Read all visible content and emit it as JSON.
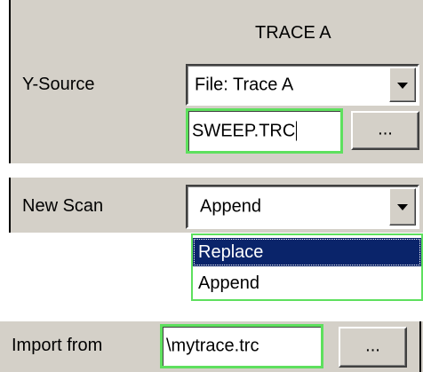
{
  "trace_panel": {
    "header": "TRACE A",
    "y_source": {
      "label": "Y-Source",
      "selected": "File: Trace A",
      "filename": "SWEEP.TRC",
      "browse_label": "..."
    }
  },
  "scan_panel": {
    "new_scan": {
      "label": "New Scan",
      "selected": "Append",
      "options": [
        "Replace",
        "Append"
      ],
      "highlighted_option": "Replace"
    }
  },
  "import_panel": {
    "label": "Import from",
    "value": "\\mytrace.trc",
    "browse_label": "..."
  },
  "colors": {
    "panel_background": "#d4d0c8",
    "focus_border": "#5ee05e",
    "selection_background": "#0a246a",
    "selection_text": "#ffffff"
  },
  "icons": {
    "dropdown_arrow": "chevron-down-icon"
  }
}
